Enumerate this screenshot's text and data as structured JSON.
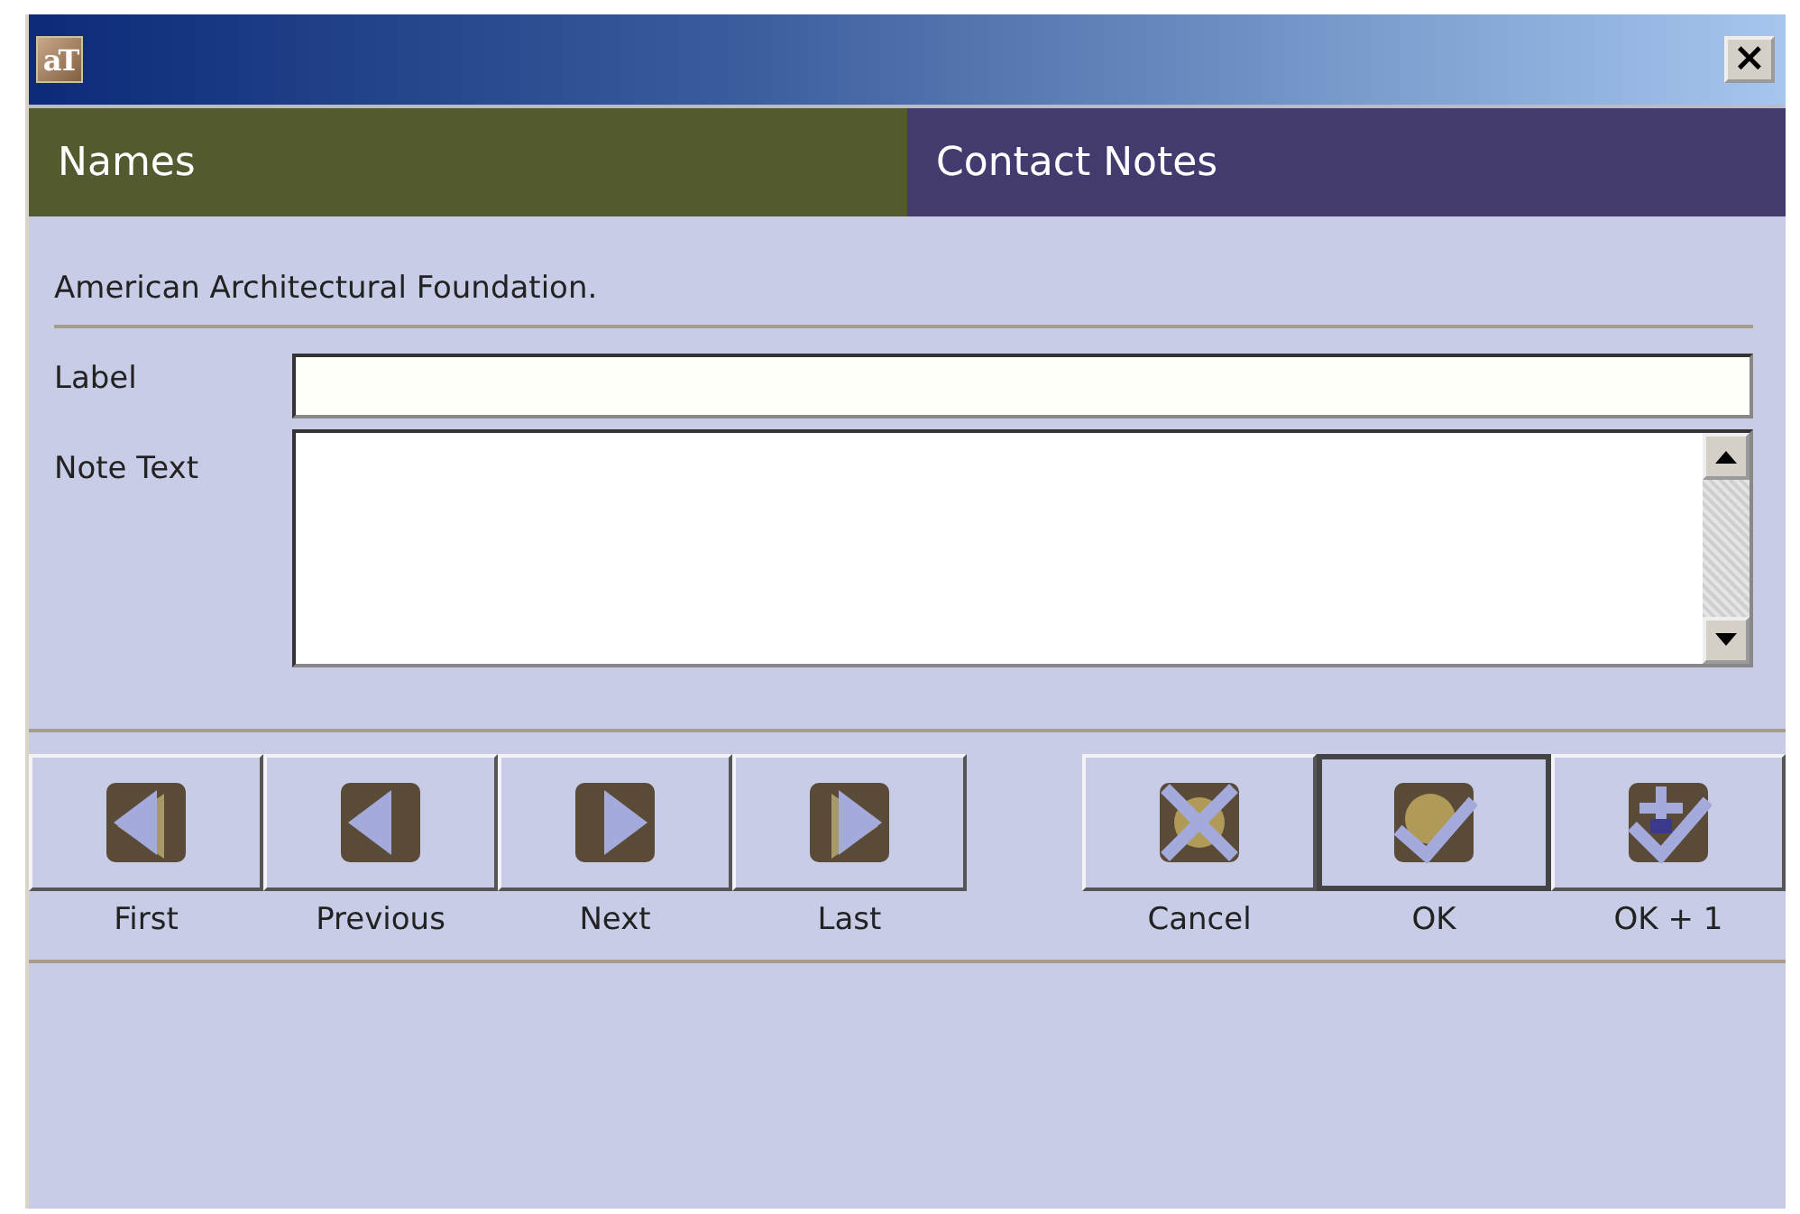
{
  "window": {
    "icon_text": "aT",
    "close": "×"
  },
  "tabs": [
    {
      "label": "Names",
      "selected": false
    },
    {
      "label": "Contact Notes",
      "selected": true
    }
  ],
  "record_name": "American Architectural Foundation.",
  "form": {
    "label_caption": "Label",
    "note_caption": "Note Text"
  },
  "nav_buttons": [
    {
      "kind": "first",
      "label": "First"
    },
    {
      "kind": "previous",
      "label": "Previous"
    },
    {
      "kind": "next",
      "label": "Next"
    },
    {
      "kind": "last",
      "label": "Last"
    }
  ],
  "action_buttons": [
    {
      "kind": "cancel",
      "label": "Cancel",
      "default": false
    },
    {
      "kind": "ok",
      "label": "OK",
      "default": true
    },
    {
      "kind": "ok_plus",
      "label": "OK + 1",
      "default": false
    }
  ]
}
